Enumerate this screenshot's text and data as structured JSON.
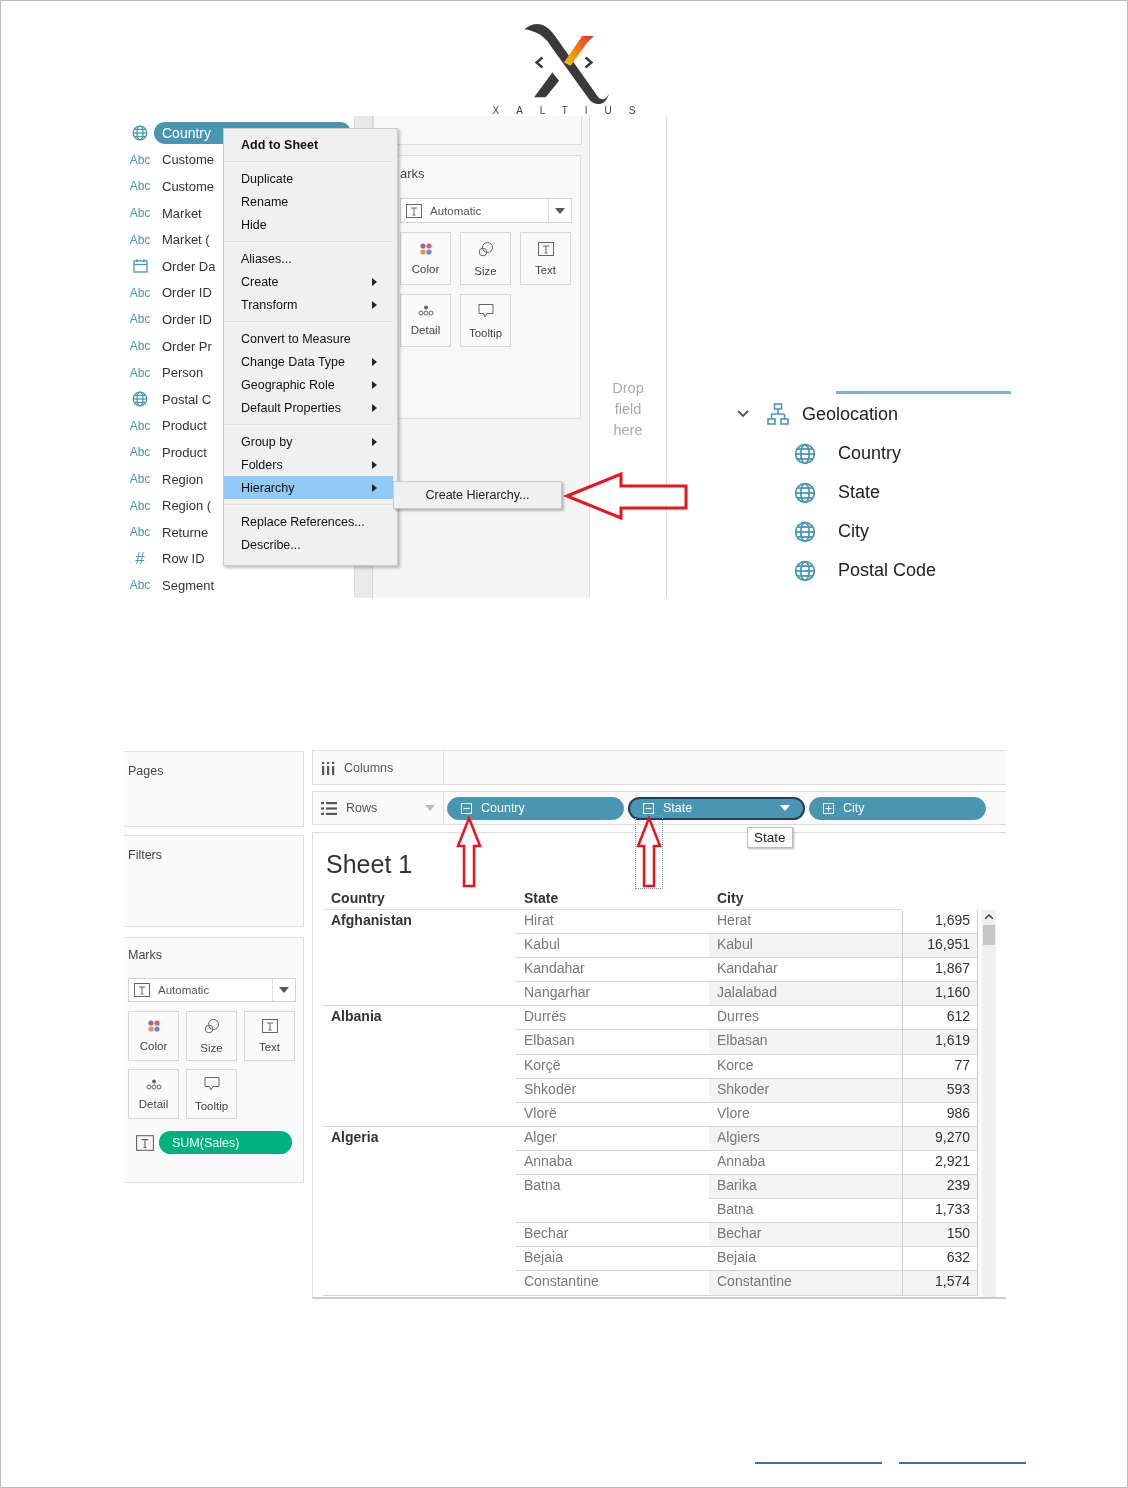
{
  "logo": {
    "wordmark": "XALTIUS"
  },
  "data_pane_figure": {
    "fields": [
      {
        "kind": "geo",
        "label": "Country",
        "selected": true
      },
      {
        "kind": "string",
        "type_label": "Abc",
        "label": "Custome",
        "selected": false
      },
      {
        "kind": "string",
        "type_label": "Abc",
        "label": "Custome",
        "selected": false
      },
      {
        "kind": "string",
        "type_label": "Abc",
        "label": "Market",
        "selected": false
      },
      {
        "kind": "string",
        "type_label": "Abc",
        "label": "Market (",
        "selected": false
      },
      {
        "kind": "date",
        "label": "Order Da",
        "selected": false
      },
      {
        "kind": "string",
        "type_label": "Abc",
        "label": "Order ID",
        "selected": false
      },
      {
        "kind": "string",
        "type_label": "Abc",
        "label": "Order ID",
        "selected": false
      },
      {
        "kind": "string",
        "type_label": "Abc",
        "label": "Order Pr",
        "selected": false
      },
      {
        "kind": "string",
        "type_label": "Abc",
        "label": "Person",
        "selected": false
      },
      {
        "kind": "geo",
        "label": "Postal C",
        "selected": false
      },
      {
        "kind": "string",
        "type_label": "Abc",
        "label": "Product",
        "selected": false
      },
      {
        "kind": "string",
        "type_label": "Abc",
        "label": "Product",
        "selected": false
      },
      {
        "kind": "string",
        "type_label": "Abc",
        "label": "Region",
        "selected": false
      },
      {
        "kind": "string",
        "type_label": "Abc",
        "label": "Region (",
        "selected": false
      },
      {
        "kind": "string",
        "type_label": "Abc",
        "label": "Returne",
        "selected": false
      },
      {
        "kind": "number",
        "type_label": "#",
        "label": "Row ID",
        "selected": false
      },
      {
        "kind": "string",
        "type_label": "Abc",
        "label": "Segment",
        "selected": false
      }
    ],
    "context_menu": {
      "groups": [
        [
          {
            "label": "Add to Sheet",
            "kind": "default",
            "submenu": false,
            "selected": false
          }
        ],
        [
          {
            "label": "Duplicate",
            "kind": "command",
            "submenu": false,
            "selected": false
          },
          {
            "label": "Rename",
            "kind": "command",
            "submenu": false,
            "selected": false
          },
          {
            "label": "Hide",
            "kind": "command",
            "submenu": false,
            "selected": false
          }
        ],
        [
          {
            "label": "Aliases...",
            "kind": "command",
            "submenu": false,
            "selected": false
          },
          {
            "label": "Create",
            "kind": "command",
            "submenu": true,
            "selected": false
          },
          {
            "label": "Transform",
            "kind": "command",
            "submenu": true,
            "selected": false
          }
        ],
        [
          {
            "label": "Convert to Measure",
            "kind": "command",
            "submenu": false,
            "selected": false
          },
          {
            "label": "Change Data Type",
            "kind": "command",
            "submenu": true,
            "selected": false
          },
          {
            "label": "Geographic Role",
            "kind": "command",
            "submenu": true,
            "selected": false
          },
          {
            "label": "Default Properties",
            "kind": "command",
            "submenu": true,
            "selected": false
          }
        ],
        [
          {
            "label": "Group by",
            "kind": "command",
            "submenu": true,
            "selected": false
          },
          {
            "label": "Folders",
            "kind": "command",
            "submenu": true,
            "selected": false
          },
          {
            "label": "Hierarchy",
            "kind": "command",
            "submenu": true,
            "selected": true
          }
        ],
        [
          {
            "label": "Replace References...",
            "kind": "command",
            "submenu": false,
            "selected": false
          },
          {
            "label": "Describe...",
            "kind": "command",
            "submenu": false,
            "selected": false
          }
        ]
      ]
    },
    "submenu": {
      "items": [
        "Create Hierarchy..."
      ]
    },
    "marks_card": {
      "title": "arks",
      "mark_type": "Automatic",
      "buttons": [
        {
          "kind": "color",
          "label": "Color"
        },
        {
          "kind": "size",
          "label": "Size"
        },
        {
          "kind": "text",
          "label": "Text"
        },
        {
          "kind": "detail",
          "label": "Detail"
        },
        {
          "kind": "tooltip",
          "label": "Tooltip"
        }
      ]
    },
    "drop_zone": {
      "text": "Drop field here"
    },
    "hierarchy": {
      "label": "Geolocation",
      "expanded": true,
      "children": [
        {
          "kind": "geo",
          "label": "Country"
        },
        {
          "kind": "geo",
          "label": "State"
        },
        {
          "kind": "geo",
          "label": "City"
        },
        {
          "kind": "geo",
          "label": "Postal Code"
        }
      ]
    }
  },
  "worksheet_figure": {
    "pages_card": {
      "title": "Pages"
    },
    "filters_card": {
      "title": "Filters"
    },
    "marks_card": {
      "title": "Marks",
      "mark_type": "Automatic",
      "buttons": [
        {
          "kind": "color",
          "label": "Color"
        },
        {
          "kind": "size",
          "label": "Size"
        },
        {
          "kind": "text",
          "label": "Text"
        },
        {
          "kind": "detail",
          "label": "Detail"
        },
        {
          "kind": "tooltip",
          "label": "Tooltip"
        }
      ],
      "pills": [
        {
          "kind": "text",
          "label": "SUM(Sales)"
        }
      ]
    },
    "columns_shelf": {
      "label": "Columns"
    },
    "rows_shelf": {
      "label": "Rows",
      "pills": [
        {
          "label": "Country",
          "expanded": true,
          "selected": false
        },
        {
          "label": "State",
          "expanded": true,
          "selected": true
        },
        {
          "label": "City",
          "expanded": false,
          "selected": false
        }
      ]
    },
    "tooltip": {
      "text": "State"
    },
    "sheet": {
      "title": "Sheet 1",
      "columns": [
        "Country",
        "State",
        "City"
      ],
      "countries": [
        {
          "name": "Afghanistan",
          "states": [
            {
              "name": "Hirat",
              "cities": [
                {
                  "name": "Herat",
                  "value": "1,695"
                }
              ]
            },
            {
              "name": "Kabul",
              "cities": [
                {
                  "name": "Kabul",
                  "value": "16,951"
                }
              ]
            },
            {
              "name": "Kandahar",
              "cities": [
                {
                  "name": "Kandahar",
                  "value": "1,867"
                }
              ]
            },
            {
              "name": "Nangarhar",
              "cities": [
                {
                  "name": "Jalalabad",
                  "value": "1,160"
                }
              ]
            }
          ]
        },
        {
          "name": "Albania",
          "states": [
            {
              "name": "Durrës",
              "cities": [
                {
                  "name": "Durres",
                  "value": "612"
                }
              ]
            },
            {
              "name": "Elbasan",
              "cities": [
                {
                  "name": "Elbasan",
                  "value": "1,619"
                }
              ]
            },
            {
              "name": "Korçë",
              "cities": [
                {
                  "name": "Korce",
                  "value": "77"
                }
              ]
            },
            {
              "name": "Shkodër",
              "cities": [
                {
                  "name": "Shkoder",
                  "value": "593"
                }
              ]
            },
            {
              "name": "Vlorë",
              "cities": [
                {
                  "name": "Vlore",
                  "value": "986"
                }
              ]
            }
          ]
        },
        {
          "name": "Algeria",
          "states": [
            {
              "name": "Alger",
              "cities": [
                {
                  "name": "Algiers",
                  "value": "9,270"
                }
              ]
            },
            {
              "name": "Annaba",
              "cities": [
                {
                  "name": "Annaba",
                  "value": "2,921"
                }
              ]
            },
            {
              "name": "Batna",
              "cities": [
                {
                  "name": "Barika",
                  "value": "239"
                },
                {
                  "name": "Batna",
                  "value": "1,733"
                }
              ]
            },
            {
              "name": "Bechar",
              "cities": [
                {
                  "name": "Bechar",
                  "value": "150"
                }
              ]
            },
            {
              "name": "Bejaia",
              "cities": [
                {
                  "name": "Bejaia",
                  "value": "632"
                }
              ]
            },
            {
              "name": "Constantine",
              "cities": [
                {
                  "name": "Constantine",
                  "value": "1,574"
                }
              ]
            }
          ]
        }
      ]
    }
  }
}
